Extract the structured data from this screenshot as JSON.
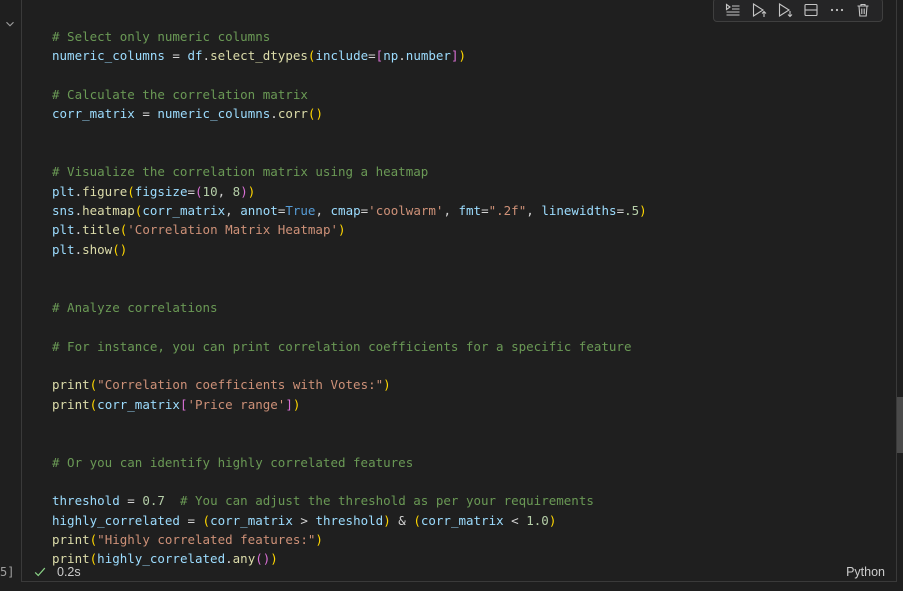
{
  "cell": {
    "execution_count": "5]",
    "duration": "0.2s",
    "language": "Python",
    "status_color": "#89d185"
  },
  "toolbar": {
    "icons": [
      "run-by-line-icon",
      "execute-above-icon",
      "execute-below-icon",
      "split-cell-icon",
      "more-icon",
      "delete-icon"
    ]
  },
  "code_lines": [
    "# Select only numeric columns",
    "numeric_columns = df.select_dtypes(include=[np.number])",
    "",
    "# Calculate the correlation matrix",
    "corr_matrix = numeric_columns.corr()",
    "",
    "",
    "# Visualize the correlation matrix using a heatmap",
    "plt.figure(figsize=(10, 8))",
    "sns.heatmap(corr_matrix, annot=True, cmap='coolwarm', fmt=\".2f\", linewidths=.5)",
    "plt.title('Correlation Matrix Heatmap')",
    "plt.show()",
    "",
    "",
    "# Analyze correlations",
    "",
    "# For instance, you can print correlation coefficients for a specific feature",
    "",
    "print(\"Correlation coefficients with Votes:\")",
    "print(corr_matrix['Price range'])",
    "",
    "",
    "# Or you can identify highly correlated features",
    "",
    "threshold = 0.7  # You can adjust the threshold as per your requirements",
    "highly_correlated = (corr_matrix > threshold) & (corr_matrix < 1.0)",
    "print(\"Highly correlated features:\")",
    "print(highly_correlated.any())"
  ],
  "colors": {
    "comment": "#6a9955",
    "variable": "#9cdcfe",
    "function": "#dcdcaa",
    "string": "#ce9178",
    "number": "#b5cea8",
    "keyword": "#569cd6",
    "bracket1": "#ffd700",
    "bracket2": "#da70d6",
    "bracket3": "#179fff"
  }
}
